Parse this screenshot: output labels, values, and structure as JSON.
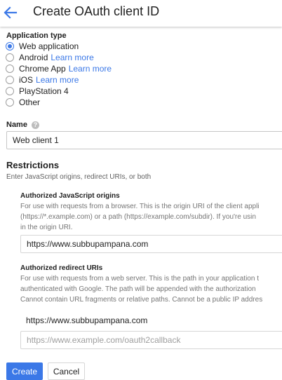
{
  "header": {
    "back_icon": "arrow-back-icon",
    "title": "Create OAuth client ID",
    "accent_color": "#3b78e7"
  },
  "application_type": {
    "label": "Application type",
    "selected": "Web application",
    "options": [
      {
        "label": "Web application",
        "link": ""
      },
      {
        "label": "Android",
        "link": "Learn more"
      },
      {
        "label": "Chrome App",
        "link": "Learn more"
      },
      {
        "label": "iOS",
        "link": "Learn more"
      },
      {
        "label": "PlayStation 4",
        "link": ""
      },
      {
        "label": "Other",
        "link": ""
      }
    ]
  },
  "name": {
    "label": "Name",
    "help_icon": "help-icon",
    "value": "Web client 1"
  },
  "restrictions": {
    "title": "Restrictions",
    "subtitle": "Enter JavaScript origins, redirect URIs, or both",
    "js_origins": {
      "title": "Authorized JavaScript origins",
      "description": [
        "For use with requests from a browser. This is the origin URI of the client appli",
        "(https://*.example.com) or a path (https://example.com/subdir). If you're usin",
        "in the origin URI."
      ],
      "value": "https://www.subbupampana.com"
    },
    "redirect_uris": {
      "title": "Authorized redirect URIs",
      "description": [
        "For use with requests from a web server. This is the path in your application t",
        "authenticated with Google. The path will be appended with the authorization",
        "Cannot contain URL fragments or relative paths. Cannot be a public IP addres"
      ],
      "value": "https://www.subbupampana.com",
      "placeholder": "https://www.example.com/oauth2callback"
    }
  },
  "actions": {
    "create_label": "Create",
    "cancel_label": "Cancel"
  }
}
